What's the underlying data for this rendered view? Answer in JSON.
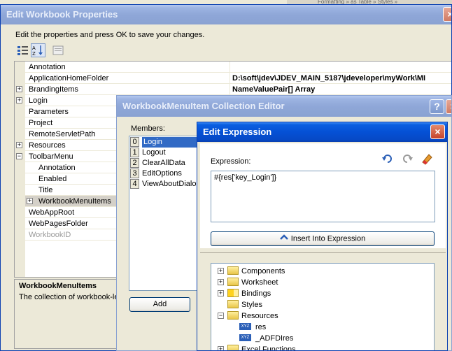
{
  "bg_top_right": "Formatting » as Table » Styles »",
  "main": {
    "title": "Edit Workbook Properties",
    "instruction": "Edit the properties and press OK to save your changes.",
    "toolbar": {
      "categorized_icon": "categorized-icon",
      "alpha_sort_icon": "alphabetical-sort-icon",
      "pages_icon": "property-pages-icon"
    },
    "properties": [
      {
        "name": "Annotation",
        "value": ""
      },
      {
        "name": "ApplicationHomeFolder",
        "value": "D:\\soft\\jdev\\JDEV_MAIN_5187\\jdeveloper\\myWork\\MI"
      },
      {
        "name": "BrandingItems",
        "value": "NameValuePair[] Array"
      },
      {
        "name": "Login",
        "value": ""
      },
      {
        "name": "Parameters",
        "value": ""
      },
      {
        "name": "Project",
        "value": ""
      },
      {
        "name": "RemoteServletPath",
        "value": ""
      },
      {
        "name": "Resources",
        "value": ""
      },
      {
        "name": "ToolbarMenu",
        "value": ""
      },
      {
        "name": "Annotation",
        "value": ""
      },
      {
        "name": "Enabled",
        "value": ""
      },
      {
        "name": "Title",
        "value": ""
      },
      {
        "name": "WorkbookMenuItems",
        "value": ""
      },
      {
        "name": "WebAppRoot",
        "value": ""
      },
      {
        "name": "WebPagesFolder",
        "value": ""
      },
      {
        "name": "WorkbookID",
        "value": ""
      }
    ],
    "desc_title": "WorkbookMenuItems",
    "desc_text": "The collection of workbook-le"
  },
  "collection": {
    "title": "WorkbookMenuItem Collection Editor",
    "members_label": "Members:",
    "members": [
      {
        "index": "0",
        "name": "Login"
      },
      {
        "index": "1",
        "name": "Logout"
      },
      {
        "index": "2",
        "name": "ClearAllData"
      },
      {
        "index": "3",
        "name": "EditOptions"
      },
      {
        "index": "4",
        "name": "ViewAboutDialo"
      }
    ],
    "add_label": "Add",
    "help_glyph": "?",
    "close_glyph": "×"
  },
  "expr": {
    "title": "Edit Expression",
    "close_glyph": "×",
    "expression_label": "Expression:",
    "expression_value": "#{res['key_Login']}",
    "insert_label": "Insert Into Expression",
    "tree": [
      {
        "label": "Components",
        "badge": ""
      },
      {
        "label": "Worksheet",
        "badge": ""
      },
      {
        "label": "Bindings",
        "badge": ""
      },
      {
        "label": "Styles",
        "badge": ""
      },
      {
        "label": "Resources",
        "badge": ""
      },
      {
        "label": "res",
        "badge": "XYZ"
      },
      {
        "label": "_ADFDIres",
        "badge": "XYZ"
      },
      {
        "label": "Excel Functions",
        "badge": ""
      }
    ]
  }
}
